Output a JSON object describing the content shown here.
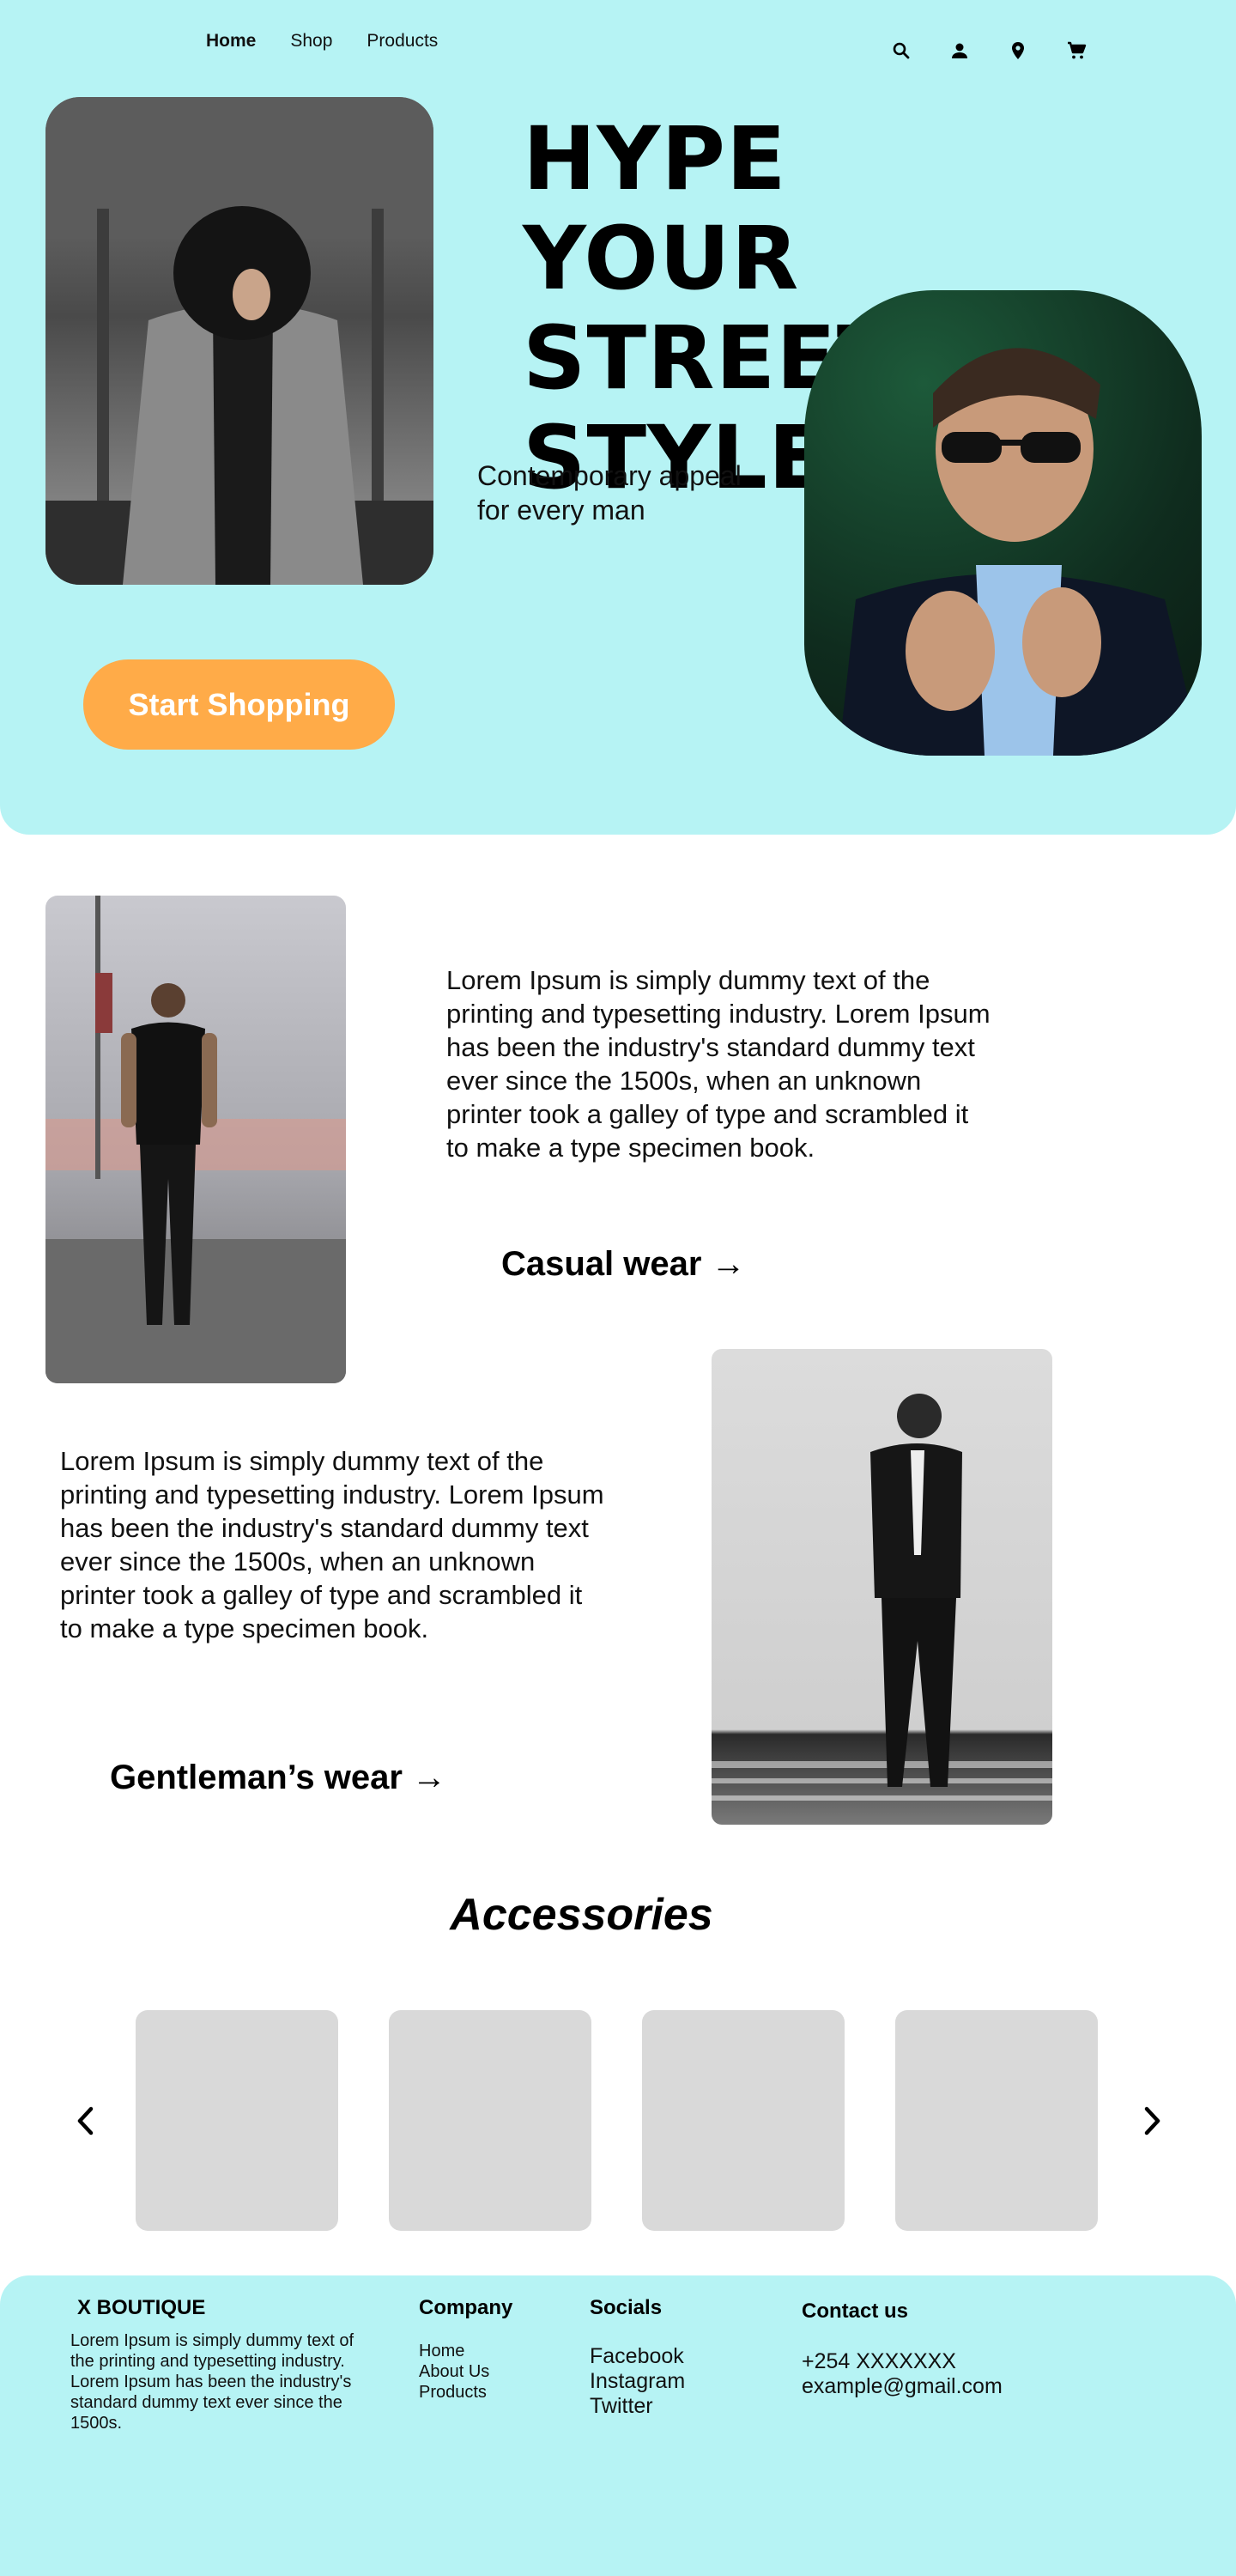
{
  "nav": {
    "links": [
      "Home",
      "Shop",
      "Products"
    ],
    "icons": [
      "search-icon",
      "user-icon",
      "location-icon",
      "cart-icon"
    ]
  },
  "hero": {
    "title_lines": [
      "HYPE YOUR",
      "STREET",
      "STYLE"
    ],
    "subtitle_lines": [
      "Contemporary appeal",
      "for every man"
    ],
    "cta_label": "Start Shopping"
  },
  "sections": {
    "casual": {
      "text": "Lorem Ipsum is simply dummy text of the printing and typesetting industry. Lorem Ipsum has been the industry's standard dummy text ever since the 1500s, when an unknown printer took a galley of type and scrambled it to make a type specimen book.",
      "link_label": "Casual wear →"
    },
    "gentleman": {
      "text": "Lorem Ipsum is simply dummy text of the printing and typesetting industry. Lorem Ipsum has been the industry's standard dummy text ever since the 1500s, when an unknown printer took a galley of type and scrambled it to make a type specimen book.",
      "link_label": "Gentleman’s wear →"
    }
  },
  "accessories": {
    "title": "Accessories",
    "prev_icon": "chevron-left-icon",
    "next_icon": "chevron-right-icon"
  },
  "footer": {
    "brand": "X BOUTIQUE",
    "brand_desc": "Lorem Ipsum is simply dummy text of the printing and typesetting industry. Lorem Ipsum has been the industry's standard dummy text ever since the 1500s.",
    "company": {
      "title": "Company",
      "items": [
        "Home",
        "About Us",
        "Products"
      ]
    },
    "socials": {
      "title": "Socials",
      "items": [
        "Facebook",
        "Instagram",
        "Twitter"
      ]
    },
    "contact": {
      "title": "Contact us",
      "items": [
        "+254 XXXXXXX",
        "example@gmail.com"
      ]
    }
  },
  "colors": {
    "hero_bg": "#b6f3f4",
    "accent": "#ffab48",
    "card_placeholder": "#d9d9d9",
    "text": "#0a0a0a"
  }
}
